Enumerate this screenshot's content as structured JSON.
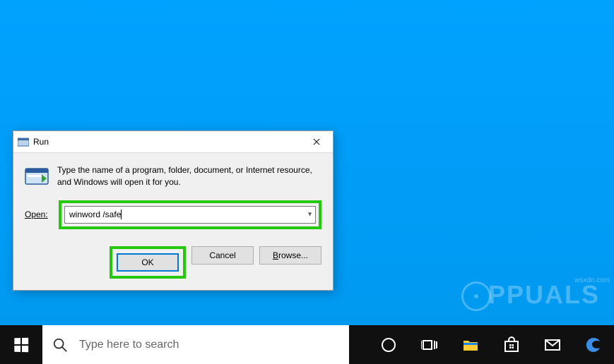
{
  "run_dialog": {
    "title": "Run",
    "description": "Type the name of a program, folder, document, or Internet resource, and Windows will open it for you.",
    "open_label": "Open:",
    "input_value": "winword /safe",
    "buttons": {
      "ok": "OK",
      "cancel": "Cancel",
      "browse_prefix": "B",
      "browse_rest": "rowse..."
    }
  },
  "taskbar": {
    "search_placeholder": "Type here to search"
  },
  "watermark": {
    "text": "PPUALS"
  },
  "attribution": "wsxdn.com"
}
